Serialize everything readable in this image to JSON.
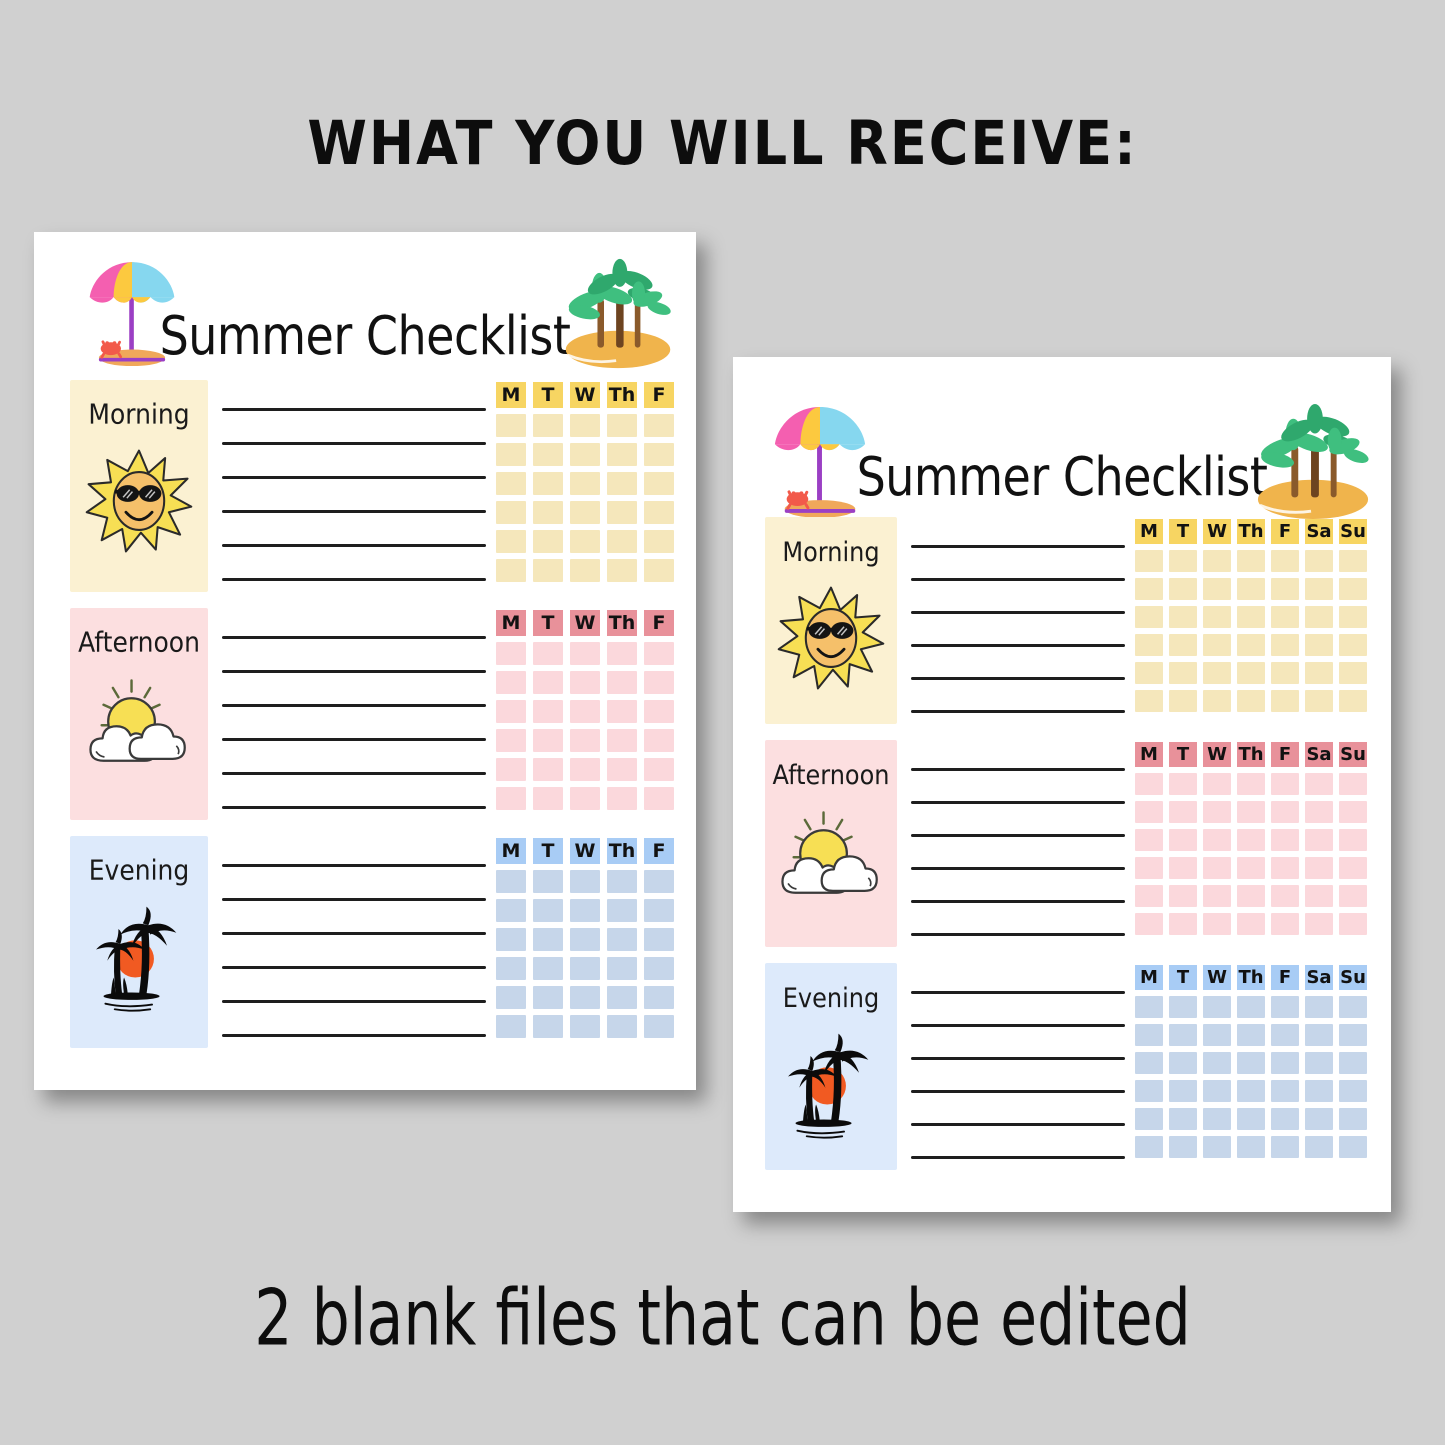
{
  "headline": "WHAT YOU WILL RECEIVE:",
  "footline": "2 blank files that can be edited",
  "background_color": "#d0d0d0",
  "sheets": [
    {
      "id": "sheet-1",
      "title": "Summer Checklist",
      "days": [
        "M",
        "T",
        "W",
        "Th",
        "F"
      ],
      "line_count": 6,
      "cell_rows": 6,
      "decor": {
        "top_left_icon": "beach-umbrella-icon",
        "top_right_icon": "palm-island-icon"
      },
      "sections": [
        {
          "label": "Morning",
          "icon": "sun-sunglasses-icon",
          "panel_color": "#fbf1d2",
          "head_color": "#f7d562",
          "cell_color": "#f5e7bb"
        },
        {
          "label": "Afternoon",
          "icon": "sun-behind-cloud-icon",
          "panel_color": "#fcdfe0",
          "head_color": "#e8919a",
          "cell_color": "#fbd8dc"
        },
        {
          "label": "Evening",
          "icon": "palm-sunset-icon",
          "panel_color": "#ddeafb",
          "head_color": "#a8ccf5",
          "cell_color": "#c6d6ea"
        }
      ]
    },
    {
      "id": "sheet-2",
      "title": "Summer Checklist",
      "days": [
        "M",
        "T",
        "W",
        "Th",
        "F",
        "Sa",
        "Su"
      ],
      "line_count": 6,
      "cell_rows": 6,
      "decor": {
        "top_left_icon": "beach-umbrella-icon",
        "top_right_icon": "palm-island-icon"
      },
      "sections": [
        {
          "label": "Morning",
          "icon": "sun-sunglasses-icon",
          "panel_color": "#fbf1d2",
          "head_color": "#f7d562",
          "cell_color": "#f5e7bb"
        },
        {
          "label": "Afternoon",
          "icon": "sun-behind-cloud-icon",
          "panel_color": "#fcdfe0",
          "head_color": "#e8919a",
          "cell_color": "#fbd8dc"
        },
        {
          "label": "Evening",
          "icon": "palm-sunset-icon",
          "panel_color": "#ddeafb",
          "head_color": "#a8ccf5",
          "cell_color": "#c6d6ea"
        }
      ]
    }
  ],
  "palette": {
    "umbrella_pink": "#f45fb0",
    "umbrella_yellow": "#fcc93f",
    "umbrella_blue": "#86d7ef",
    "umbrella_pole": "#9b3fc4",
    "sand": "#f0a85a",
    "crab": "#f25a4a",
    "palm_green": "#3fbf7f",
    "palm_trunk": "#8a5a2b",
    "island_sand": "#f0b44c",
    "sun_yellow": "#f7df54",
    "sun_face": "#f5c06a",
    "sunset_orange": "#f15a22",
    "ink": "#1e1e1e"
  }
}
